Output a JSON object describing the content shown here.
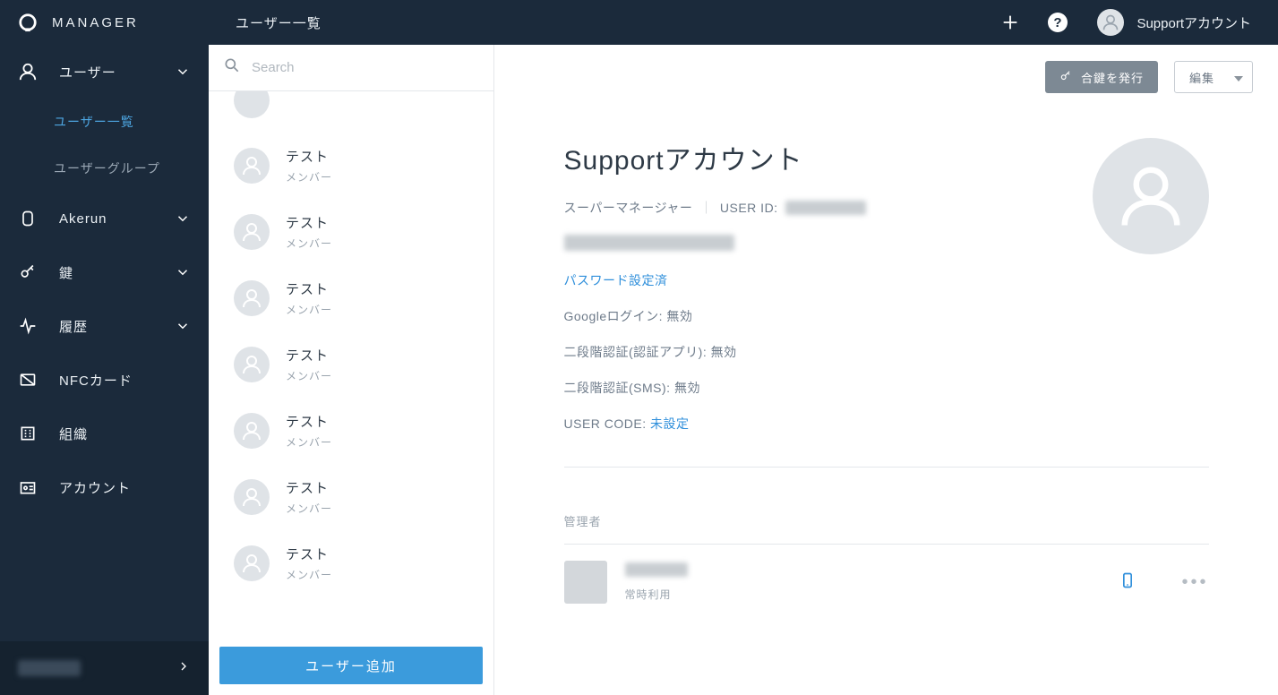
{
  "brand": "MANAGER",
  "sidebar": {
    "items": [
      {
        "label": "ユーザー"
      },
      {
        "label": "Akerun"
      },
      {
        "label": "鍵"
      },
      {
        "label": "履歴"
      },
      {
        "label": "NFCカード"
      },
      {
        "label": "組織"
      },
      {
        "label": "アカウント"
      }
    ],
    "sub_users": [
      {
        "label": "ユーザー一覧"
      },
      {
        "label": "ユーザーグループ"
      }
    ]
  },
  "header": {
    "title": "ユーザー一覧",
    "account_name": "Supportアカウント"
  },
  "user_list": {
    "search_placeholder": "Search",
    "add_button": "ユーザー追加",
    "items": [
      {
        "name": "テスト",
        "role": "メンバー"
      },
      {
        "name": "テスト",
        "role": "メンバー"
      },
      {
        "name": "テスト",
        "role": "メンバー"
      },
      {
        "name": "テスト",
        "role": "メンバー"
      },
      {
        "name": "テスト",
        "role": "メンバー"
      },
      {
        "name": "テスト",
        "role": "メンバー"
      },
      {
        "name": "テスト",
        "role": "メンバー"
      }
    ]
  },
  "detail": {
    "issue_key_button": "合鍵を発行",
    "edit_button": "編集",
    "name": "Supportアカウント",
    "role": "スーパーマネージャー",
    "user_id_label": "USER ID:",
    "password_status": "パスワード設定済",
    "google_login": "Googleログイン: 無効",
    "mfa_app": "二段階認証(認証アプリ): 無効",
    "mfa_sms": "二段階認証(SMS): 無効",
    "user_code_label": "USER CODE: ",
    "user_code_value": "未設定",
    "section_admin": "管理者",
    "device_usage": "常時利用"
  }
}
